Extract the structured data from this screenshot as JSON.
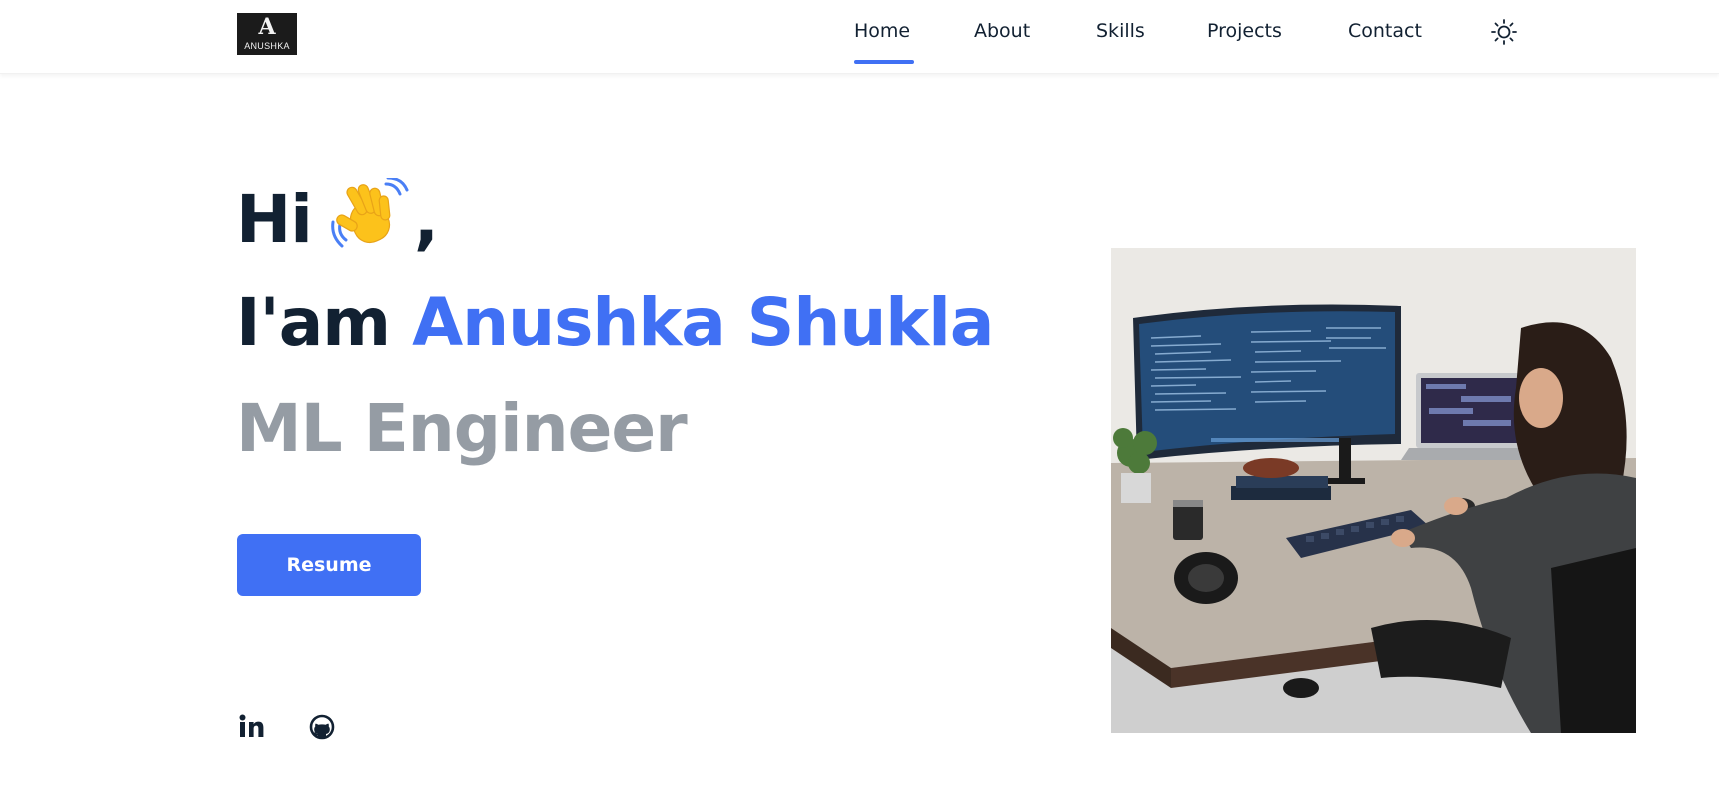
{
  "brand": {
    "logo_letter": "A",
    "logo_text": "ANUSHKA"
  },
  "nav": {
    "items": [
      {
        "label": "Home",
        "active": true
      },
      {
        "label": "About",
        "active": false
      },
      {
        "label": "Skills",
        "active": false
      },
      {
        "label": "Projects",
        "active": false
      },
      {
        "label": "Contact",
        "active": false
      }
    ],
    "theme_icon": "sun-icon"
  },
  "hero": {
    "greeting": "Hi",
    "greeting_emoji": "waving-hand",
    "greeting_suffix": ",",
    "intro": "I'am",
    "name": "Anushka Shukla",
    "role": "ML Engineer",
    "resume_label": "Resume"
  },
  "social": [
    {
      "icon": "linkedin-icon"
    },
    {
      "icon": "github-icon"
    }
  ],
  "colors": {
    "accent": "#4070f4",
    "text_dark": "#122132",
    "text_muted": "#959ca4"
  }
}
